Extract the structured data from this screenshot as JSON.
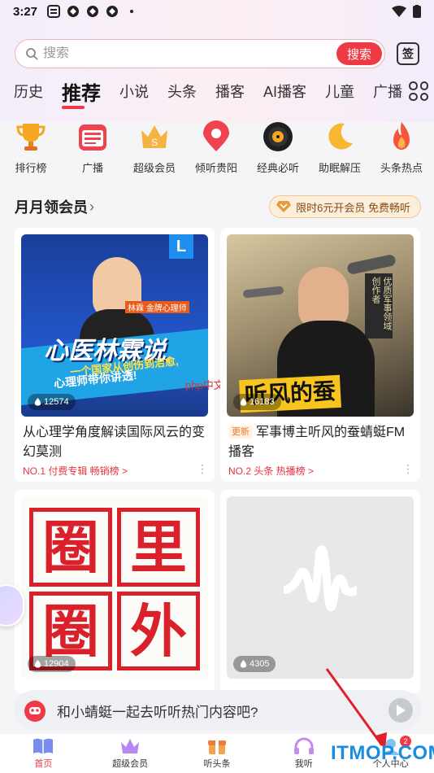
{
  "status_bar": {
    "time": "3:27"
  },
  "search": {
    "placeholder": "搜索",
    "button_label": "搜索",
    "sign_label": "签"
  },
  "tabs": [
    {
      "label": "历史"
    },
    {
      "label": "推荐"
    },
    {
      "label": "小说"
    },
    {
      "label": "头条"
    },
    {
      "label": "播客"
    },
    {
      "label": "AI播客"
    },
    {
      "label": "儿童"
    },
    {
      "label": "广播"
    }
  ],
  "quick_access": [
    {
      "label": "排行榜",
      "icon": "trophy-icon"
    },
    {
      "label": "广播",
      "icon": "radio-icon"
    },
    {
      "label": "超级会员",
      "icon": "crown-icon"
    },
    {
      "label": "倾听贵阳",
      "icon": "location-pin-icon"
    },
    {
      "label": "经典必听",
      "icon": "vinyl-record-icon"
    },
    {
      "label": "助眠解压",
      "icon": "moon-icon"
    },
    {
      "label": "头条热点",
      "icon": "flame-icon"
    }
  ],
  "section": {
    "title": "月月领会员",
    "promo": "限时6元开会员 免费畅听"
  },
  "cards": [
    {
      "title": "从心理学角度解读国际风云的变幻莫测",
      "new_badge": "",
      "meta": "NO.1 付费专辑 畅销榜 >",
      "plays": "12574",
      "cover_text": {
        "main": "心医林霖说",
        "sub1": "一个国家从创伤到治愈,",
        "sub2": "心理师带你讲透!",
        "tag": "林霖 金牌心理师",
        "logo": "L"
      }
    },
    {
      "title": "军事博主听风的蚕蜻蜓FM播客",
      "new_badge": "更新",
      "meta": "NO.2 头条 热播榜 >",
      "plays": "16183",
      "cover_text": {
        "main": "听风的蚕",
        "side": "优质军事领域创作者"
      }
    },
    {
      "title": "",
      "new_badge": "",
      "meta": "",
      "plays": "12904",
      "cover_text": {
        "c1": "圈",
        "c2": "里",
        "c3": "圈",
        "c4": "外"
      }
    },
    {
      "title": "",
      "new_badge": "",
      "meta": "",
      "plays": "4305",
      "cover_text": {}
    }
  ],
  "chat": {
    "text": "和小蜻蜓一起去听听热门内容吧?"
  },
  "bottom_nav": [
    {
      "label": "首页",
      "icon": "book-icon",
      "active": true
    },
    {
      "label": "超级会员",
      "icon": "crown-icon"
    },
    {
      "label": "听头条",
      "icon": "gift-box-icon"
    },
    {
      "label": "我听",
      "icon": "headphones-icon"
    },
    {
      "label": "个人中心",
      "icon": "profile-icon",
      "badge": "2"
    }
  ],
  "watermarks": {
    "site": "ITMOP.COM",
    "php": "php中文网"
  },
  "colors": {
    "accent": "#ee3a45",
    "promo_bg": "#fbeedb",
    "meta_red": "#e8333e"
  }
}
